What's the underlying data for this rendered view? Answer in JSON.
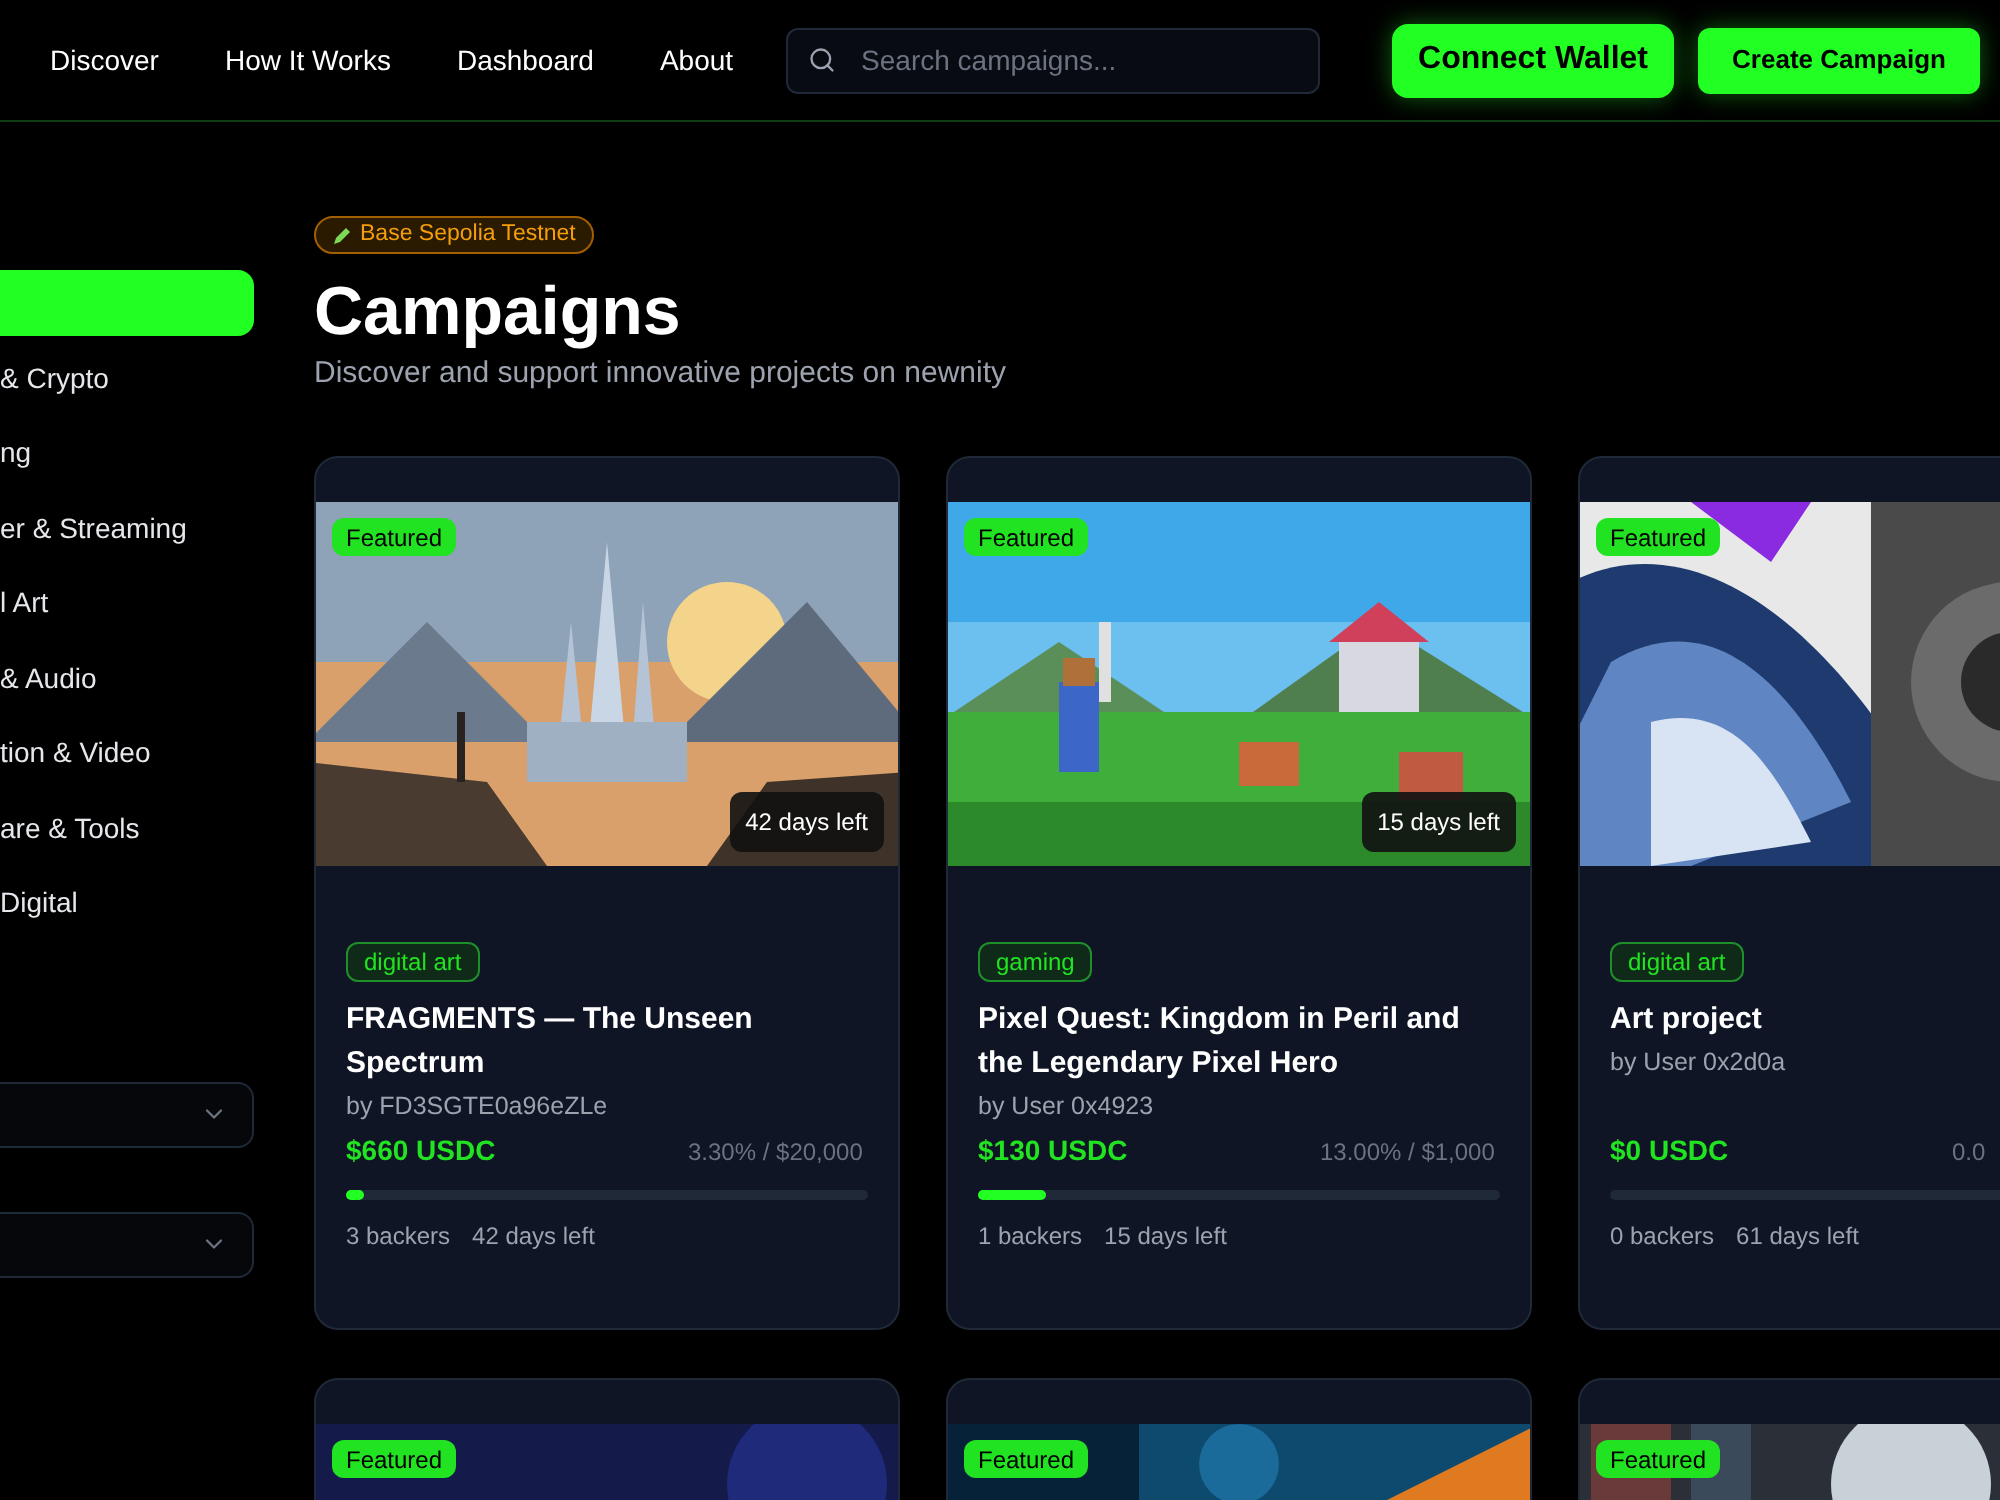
{
  "nav": {
    "links": [
      "Discover",
      "How It Works",
      "Dashboard",
      "About"
    ],
    "search": {
      "placeholder": "Search campaigns..."
    },
    "buttons": [
      {
        "label": "Connect Wallet",
        "kind": "wallet"
      },
      {
        "label": "Create Campaign",
        "kind": "create"
      }
    ]
  },
  "sidebar": {
    "categories": [
      {
        "selected": true
      },
      {
        "label": "& Crypto",
        "selected": false
      },
      {
        "label": "ng",
        "selected": false
      },
      {
        "label": "er & Streaming",
        "selected": false
      },
      {
        "label": "l Art",
        "selected": false
      },
      {
        "label": "& Audio",
        "selected": false
      },
      {
        "label": "tion & Video",
        "selected": false
      },
      {
        "label": "are & Tools",
        "selected": false
      },
      {
        "label": "Digital",
        "selected": false
      }
    ],
    "dropdowns": [
      {
        "kind": "select"
      },
      {
        "kind": "select"
      }
    ]
  },
  "main": {
    "network_badge": "Base Sepolia Testnet",
    "title": "Campaigns",
    "subtitle": "Discover and support innovative projects on newnity",
    "campaigns": [
      {
        "featured": "Featured",
        "kind": "picture",
        "days_badge": "42 days left",
        "tag": "digital art",
        "title": "FRAGMENTS — The Unseen Spectrum",
        "author": "by FD3SGTE0a96eZLe",
        "raised": "$660 USDC",
        "progress": "3.30% / $20,000",
        "level": 0.033,
        "backers": "3 backers",
        "days_left": "42 days left"
      },
      {
        "featured": "Featured",
        "kind": "picture",
        "days_badge": "15 days left",
        "tag": "gaming",
        "title": "Pixel Quest: Kingdom in Peril and the Legendary Pixel Hero",
        "author": "by User 0x4923",
        "raised": "$130 USDC",
        "progress": "13.00% / $1,000",
        "level": 0.13,
        "backers": "1 backers",
        "days_left": "15 days left"
      },
      {
        "featured": "Featured",
        "kind": "picture",
        "tag": "digital art",
        "title": "Art project",
        "author": "by User 0x2d0a",
        "raised": "$0 USDC",
        "progress": "0.0",
        "level": 0,
        "backers": "0 backers",
        "days_left": "61 days left"
      },
      {
        "featured": "Featured",
        "kind": "picture"
      },
      {
        "featured": "Featured",
        "kind": "picture"
      },
      {
        "featured": "Featured",
        "kind": "picture"
      }
    ]
  }
}
